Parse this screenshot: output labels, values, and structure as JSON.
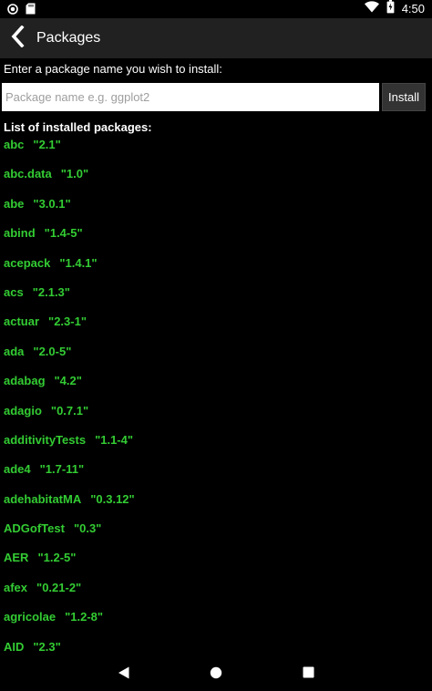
{
  "status_bar": {
    "time": "4:50"
  },
  "toolbar": {
    "title": "Packages"
  },
  "install": {
    "prompt": "Enter a package name you wish to install:",
    "placeholder": "Package name e.g. ggplot2",
    "value": "",
    "button_label": "Install"
  },
  "installed": {
    "heading": "List of installed packages:",
    "packages": [
      {
        "name": "abc",
        "version": "\"2.1\""
      },
      {
        "name": "abc.data",
        "version": "\"1.0\""
      },
      {
        "name": "abe",
        "version": "\"3.0.1\""
      },
      {
        "name": "abind",
        "version": "\"1.4-5\""
      },
      {
        "name": "acepack",
        "version": "\"1.4.1\""
      },
      {
        "name": "acs",
        "version": "\"2.1.3\""
      },
      {
        "name": "actuar",
        "version": "\"2.3-1\""
      },
      {
        "name": "ada",
        "version": "\"2.0-5\""
      },
      {
        "name": "adabag",
        "version": "\"4.2\""
      },
      {
        "name": "adagio",
        "version": "\"0.7.1\""
      },
      {
        "name": "additivityTests",
        "version": "\"1.1-4\""
      },
      {
        "name": "ade4",
        "version": "\"1.7-11\""
      },
      {
        "name": "adehabitatMA",
        "version": "\"0.3.12\""
      },
      {
        "name": "ADGofTest",
        "version": "\"0.3\""
      },
      {
        "name": "AER",
        "version": "\"1.2-5\""
      },
      {
        "name": "afex",
        "version": "\"0.21-2\""
      },
      {
        "name": "agricolae",
        "version": "\"1.2-8\""
      },
      {
        "name": "AID",
        "version": "\"2.3\""
      }
    ]
  },
  "colors": {
    "background": "#000000",
    "toolbar": "#212121",
    "package_text": "#33cc33",
    "text": "#ffffff"
  },
  "icons": {
    "status_left": [
      "record-icon",
      "sd-card-icon"
    ],
    "status_right": [
      "wifi-icon",
      "battery-icon"
    ],
    "toolbar": "chevron-left-icon",
    "nav": [
      "back-triangle-icon",
      "home-circle-icon",
      "recents-square-icon"
    ]
  }
}
